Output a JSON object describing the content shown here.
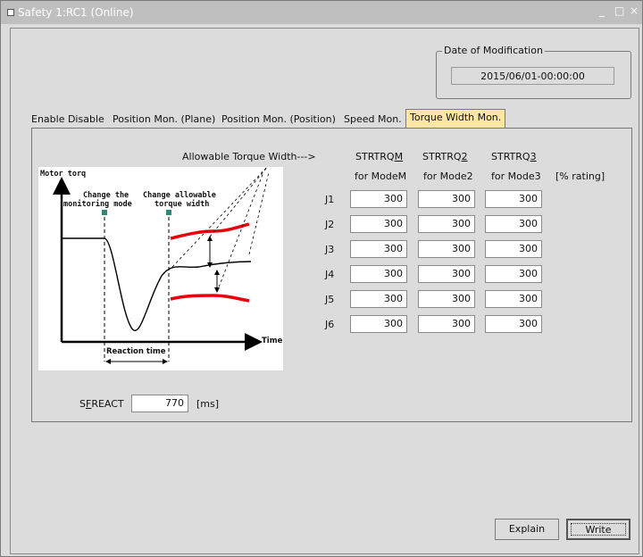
{
  "window": {
    "title": "Safety 1:RC1 (Online)",
    "minimize_glyph": "_",
    "restore_glyph": "□",
    "close_glyph": "×"
  },
  "date_group": {
    "label": "Date of Modification",
    "value": "2015/06/01-00:00:00"
  },
  "tabs": [
    {
      "label": "Enable Disable"
    },
    {
      "label": "Position Mon. (Plane)"
    },
    {
      "label": "Position Mon. (Position)"
    },
    {
      "label": "Speed Mon."
    },
    {
      "label": "Torque Width Mon.",
      "active": true
    }
  ],
  "grid": {
    "allowable_label": "Allowable Torque Width--->",
    "col_headers": [
      {
        "name_pre": "STRTRQ",
        "name_mnemonic": "M",
        "sub": "for ModeM"
      },
      {
        "name_pre": "STRTRQ",
        "name_mnemonic": "2",
        "sub": "for Mode2"
      },
      {
        "name_pre": "STRTRQ",
        "name_mnemonic": "3",
        "sub": "for Mode3"
      }
    ],
    "unit": "[% rating]",
    "rows": [
      {
        "label": "J1",
        "values": [
          "300",
          "300",
          "300"
        ]
      },
      {
        "label": "J2",
        "values": [
          "300",
          "300",
          "300"
        ]
      },
      {
        "label": "J3",
        "values": [
          "300",
          "300",
          "300"
        ]
      },
      {
        "label": "J4",
        "values": [
          "300",
          "300",
          "300"
        ]
      },
      {
        "label": "J5",
        "values": [
          "300",
          "300",
          "300"
        ]
      },
      {
        "label": "J6",
        "values": [
          "300",
          "300",
          "300"
        ]
      }
    ]
  },
  "diagram": {
    "y_label": "Motor torq",
    "x_label": "Time",
    "annot_change_mode_1": "Change the",
    "annot_change_mode_2": "monitoring mode",
    "annot_change_width_1": "Change allowable",
    "annot_change_width_2": "torque width",
    "reaction_label": "Reaction time"
  },
  "sfreact": {
    "label_pre": "S",
    "label_mnemonic": "F",
    "label_post": "REACT",
    "value": "770",
    "unit": "[ms]"
  },
  "buttons": {
    "explain": "Explain",
    "write": "Write"
  },
  "colors": {
    "active_tab": "#fde6a3",
    "torque_band": "#e8000b",
    "titlebar": "#bfbfbf"
  }
}
